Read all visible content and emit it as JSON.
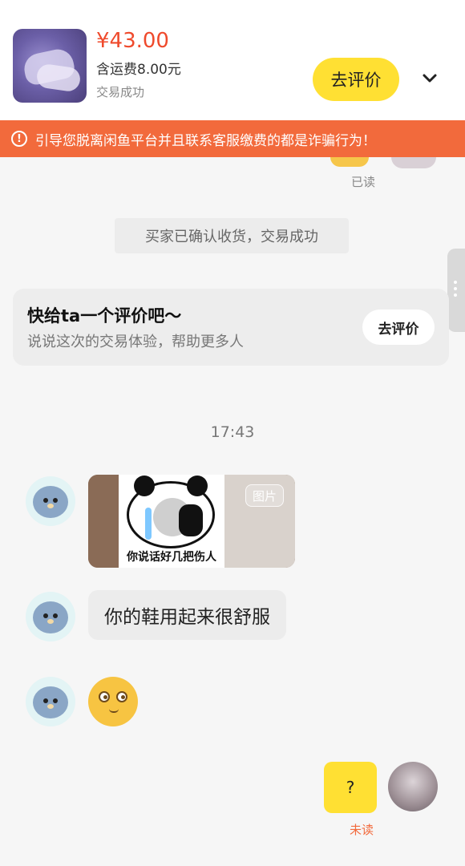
{
  "product": {
    "price": "¥43.00",
    "shipping": "含运费8.00元",
    "status": "交易成功",
    "review_button": "去评价"
  },
  "warning": {
    "text": "引导您脱离闲鱼平台并且联系客服缴费的都是诈骗行为！"
  },
  "chat": {
    "read_status": "已读",
    "system_message": "买家已确认收货，交易成功",
    "review_card": {
      "title": "快给ta一个评价吧～",
      "subtitle": "说说这次的交易体验，帮助更多人",
      "button": "去评价"
    },
    "timestamp": "17:43",
    "messages": [
      {
        "type": "image",
        "caption": "你说话好几把伤人",
        "tag": "图片"
      },
      {
        "type": "text",
        "text": "你的鞋用起来很舒服"
      },
      {
        "type": "emoji",
        "icon": "wide-eyes-emoji"
      },
      {
        "type": "text_self",
        "text": "?",
        "status": "未读"
      }
    ]
  },
  "colors": {
    "accent_yellow": "#ffe033",
    "warning_orange": "#f26a3c",
    "price_red": "#ef4a2c"
  }
}
